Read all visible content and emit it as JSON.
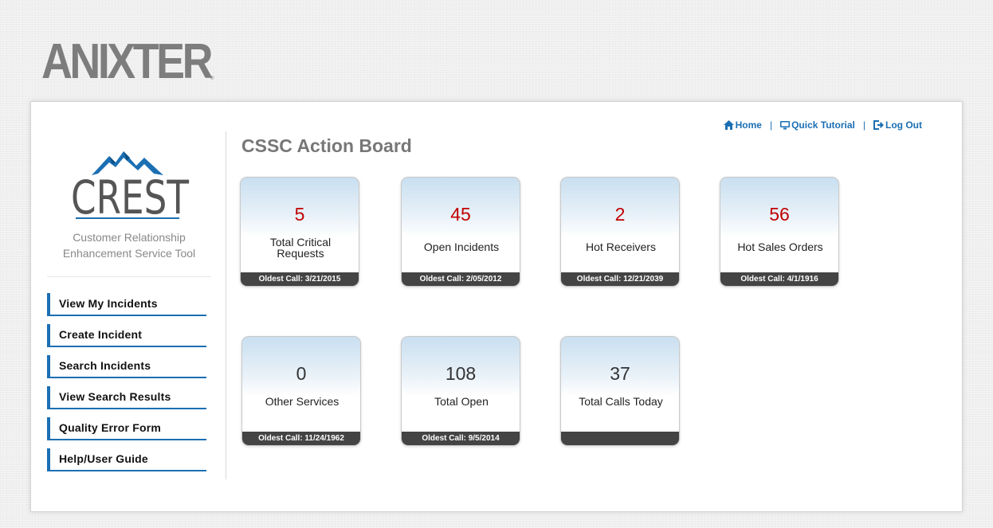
{
  "brand": {
    "logo_text": "ANIXTER"
  },
  "sidebar": {
    "crest_logo_text": "CREST",
    "subtitle_line1": "Customer Relationship",
    "subtitle_line2": "Enhancement Service Tool",
    "nav": [
      {
        "label": "View My Incidents"
      },
      {
        "label": "Create Incident"
      },
      {
        "label": "Search Incidents"
      },
      {
        "label": "View Search Results"
      },
      {
        "label": "Quality Error Form"
      },
      {
        "label": "Help/User Guide"
      }
    ]
  },
  "toplinks": {
    "home": "Home",
    "tutorial": "Quick Tutorial",
    "logout": "Log Out",
    "separator": "|"
  },
  "page": {
    "title": "CSSC Action Board"
  },
  "tiles": [
    {
      "count": "5",
      "label": "Total Critical Requests",
      "footer": "Oldest Call: 3/21/2015"
    },
    {
      "count": "45",
      "label": "Open Incidents",
      "footer": "Oldest Call: 2/05/2012"
    },
    {
      "count": "2",
      "label": "Hot Receivers",
      "footer": "Oldest Call: 12/21/2039"
    },
    {
      "count": "56",
      "label": "Hot Sales Orders",
      "footer": "Oldest Call: 4/1/1916"
    },
    {
      "count": "0",
      "label": "Other Services",
      "footer": "Oldest Call: 11/24/1962"
    },
    {
      "count": "108",
      "label": "Total Open",
      "footer": "Oldest Call: 9/5/2014"
    },
    {
      "count": "37",
      "label": "Total Calls Today",
      "footer": ""
    }
  ],
  "colors": {
    "accent": "#1b6fb3",
    "alert_count": "#c00000",
    "title_gray": "#777777",
    "footer_bar": "#444444"
  }
}
